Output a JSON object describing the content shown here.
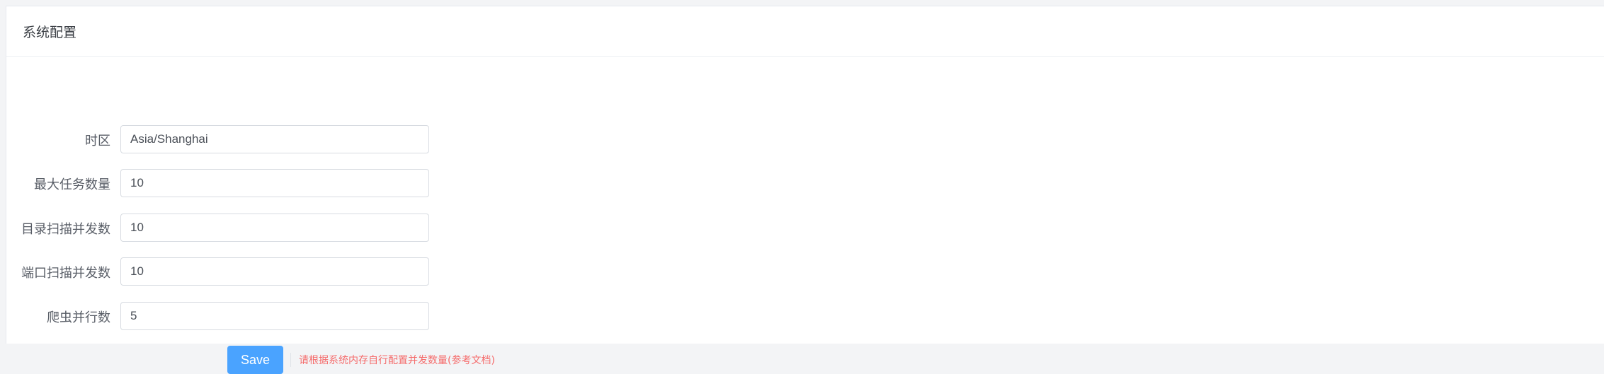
{
  "card": {
    "title": "系统配置"
  },
  "form": {
    "fields": [
      {
        "label": "时区",
        "value": "Asia/Shanghai"
      },
      {
        "label": "最大任务数量",
        "value": "10"
      },
      {
        "label": "目录扫描并发数",
        "value": "10"
      },
      {
        "label": "端口扫描并发数",
        "value": "10"
      },
      {
        "label": "爬虫并行数",
        "value": "5"
      }
    ]
  },
  "actions": {
    "save_label": "Save",
    "hint_text": "请根据系统内存自行配置并发数量(参考文档)"
  },
  "colors": {
    "primary": "#4aa3ff",
    "hint": "#f56c6c",
    "page_background": "#f3f4f6"
  }
}
